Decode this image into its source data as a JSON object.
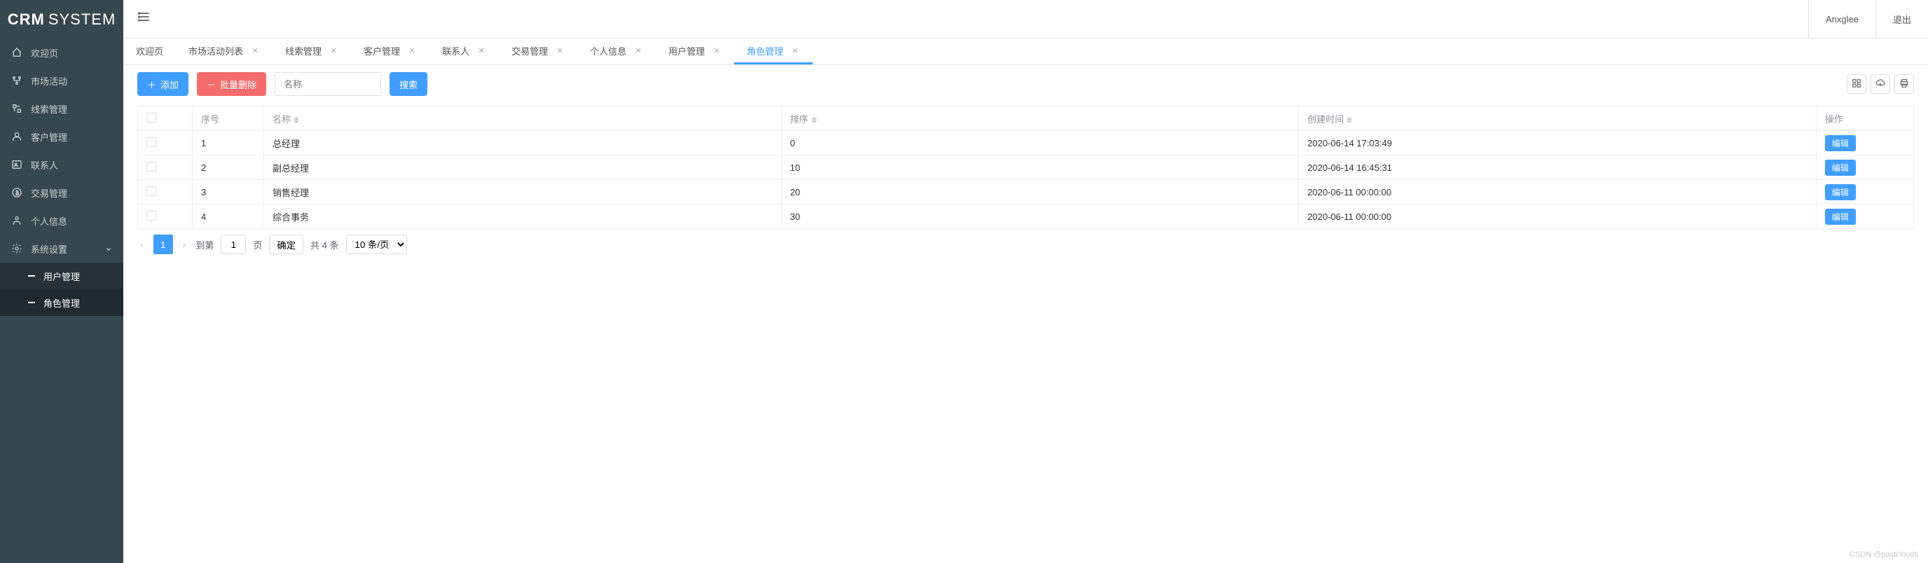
{
  "logo": {
    "text1": "CRM",
    "text2": "SYSTEM"
  },
  "header": {
    "user": "Anxglee",
    "logout": "退出"
  },
  "sidebar": {
    "items": [
      {
        "label": "欢迎页",
        "icon": "home"
      },
      {
        "label": "市场活动",
        "icon": "activity"
      },
      {
        "label": "线索管理",
        "icon": "clue"
      },
      {
        "label": "客户管理",
        "icon": "customer"
      },
      {
        "label": "联系人",
        "icon": "contact"
      },
      {
        "label": "交易管理",
        "icon": "deal"
      },
      {
        "label": "个人信息",
        "icon": "person"
      },
      {
        "label": "系统设置",
        "icon": "gear"
      }
    ],
    "subs": [
      {
        "label": "用户管理"
      },
      {
        "label": "角色管理"
      }
    ]
  },
  "tabs": [
    {
      "label": "欢迎页",
      "closable": false
    },
    {
      "label": "市场活动列表",
      "closable": true
    },
    {
      "label": "线索管理",
      "closable": true
    },
    {
      "label": "客户管理",
      "closable": true
    },
    {
      "label": "联系人",
      "closable": true
    },
    {
      "label": "交易管理",
      "closable": true
    },
    {
      "label": "个人信息",
      "closable": true
    },
    {
      "label": "用户管理",
      "closable": true
    },
    {
      "label": "角色管理",
      "closable": true,
      "active": true
    }
  ],
  "toolbar": {
    "add": "添加",
    "batch_delete": "批量删除",
    "name_placeholder": "名称",
    "search": "搜索"
  },
  "table": {
    "headers": {
      "index": "序号",
      "name": "名称",
      "sort": "排序",
      "created": "创建时间",
      "action": "操作"
    },
    "edit_label": "编辑",
    "rows": [
      {
        "index": "1",
        "name": "总经理",
        "sort": "0",
        "created": "2020-06-14 17:03:49"
      },
      {
        "index": "2",
        "name": "副总经理",
        "sort": "10",
        "created": "2020-06-14 16:45:31"
      },
      {
        "index": "3",
        "name": "销售经理",
        "sort": "20",
        "created": "2020-06-11 00:00:00"
      },
      {
        "index": "4",
        "name": "综合事务",
        "sort": "30",
        "created": "2020-06-11 00:00:00"
      }
    ]
  },
  "pager": {
    "current": "1",
    "goto_pre": "到第",
    "goto_val": "1",
    "goto_suf": "页",
    "confirm": "确定",
    "total": "共 4 条",
    "page_size": "10 条/页"
  },
  "watermark": "CSDN @pastclouds"
}
